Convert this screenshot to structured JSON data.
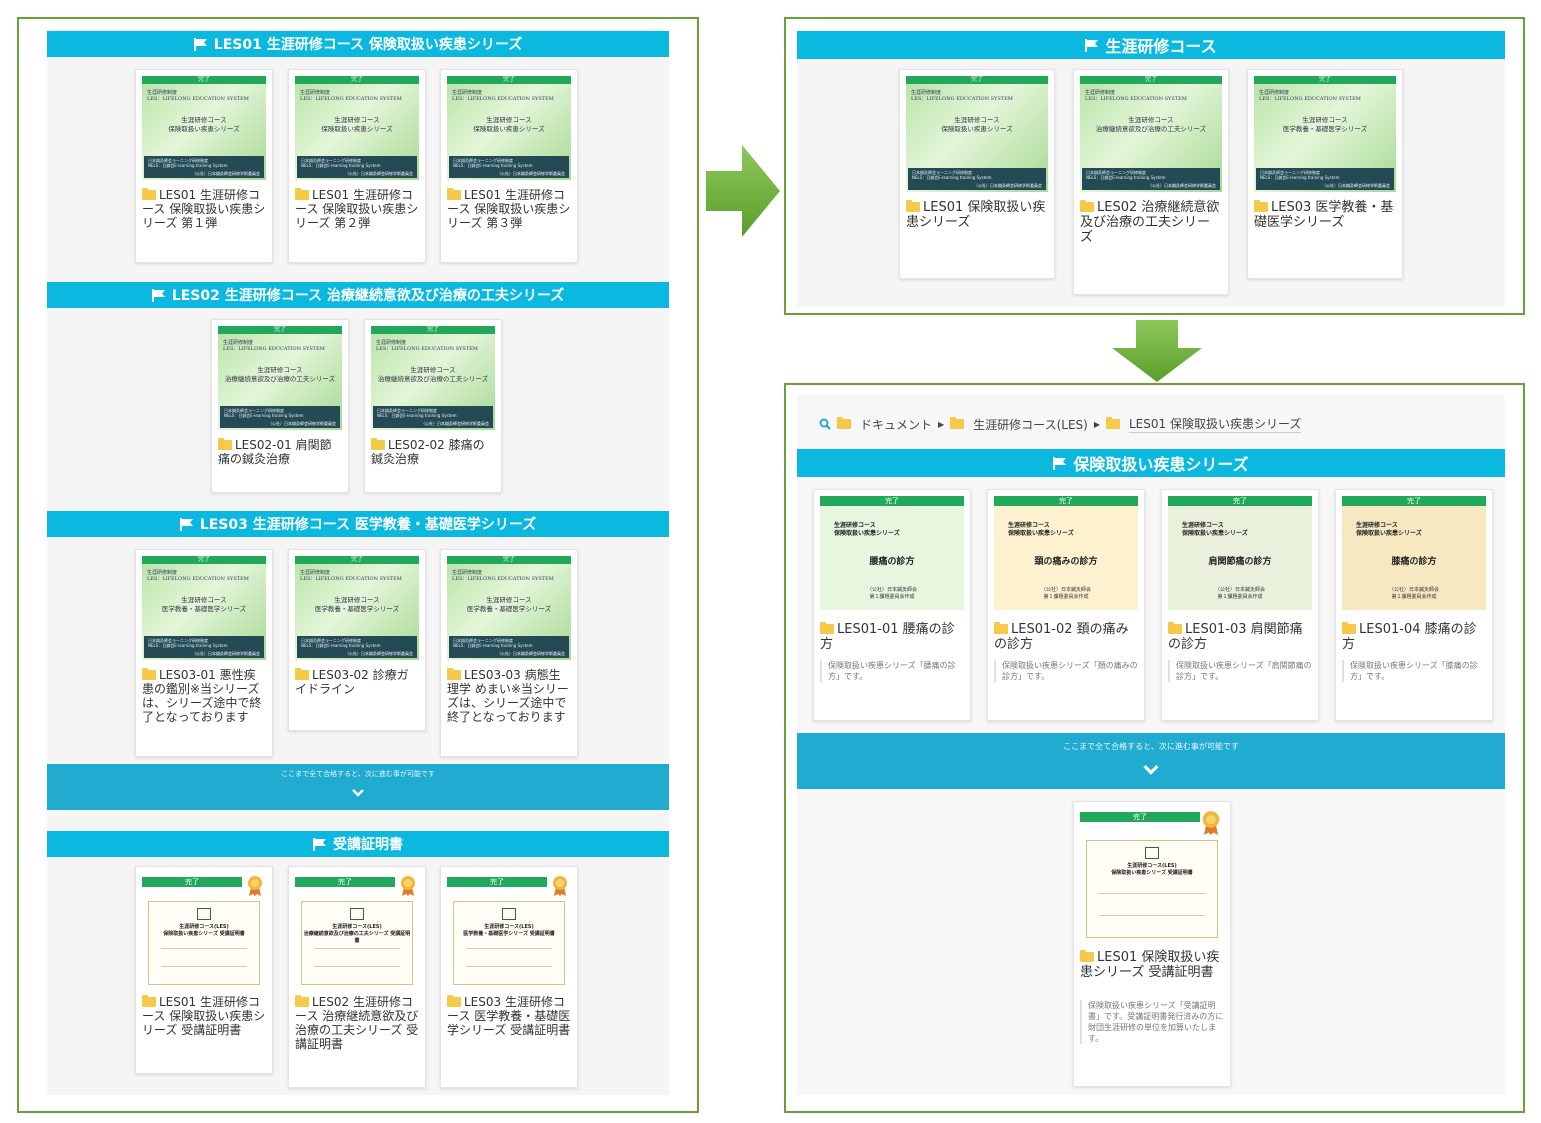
{
  "colors": {
    "section_bar": "#0bb9e0",
    "next_bar": "#21abd1",
    "done_badge": "#22a85a",
    "panel_border": "#6a9f3a",
    "arrow": "#6fb23c",
    "folder": "#f7c948"
  },
  "left_panel": {
    "sections": [
      {
        "title": "LES01 生涯研修コース 保険取扱い疾患シリーズ",
        "thumb_header": "生涯研修制度\nLES：LIFELONG EDUCATION SYSTEM",
        "thumb_subtitle": "生涯研修コース\n保険取扱い疾患シリーズ",
        "cards": [
          {
            "title": "LES01 生涯研修コース 保険取扱い疾患シリーズ 第１弾"
          },
          {
            "title": "LES01 生涯研修コース 保険取扱い疾患シリーズ 第２弾"
          },
          {
            "title": "LES01 生涯研修コース 保険取扱い疾患シリーズ 第３弾"
          }
        ]
      },
      {
        "title": "LES02 生涯研修コース 治療継続意欲及び治療の工夫シリーズ",
        "thumb_header": "生涯研修制度\nLES：LIFELONG EDUCATION SYSTEM",
        "thumb_subtitle": "生涯研修コース\n治療継続意欲及び治療の工夫シリーズ",
        "cards": [
          {
            "title": "LES02-01 肩関節痛の鍼灸治療"
          },
          {
            "title": "LES02-02 膝痛の鍼灸治療"
          }
        ]
      },
      {
        "title": "LES03 生涯研修コース 医学教養・基礎医学シリーズ",
        "thumb_header": "生涯研修制度\nLES：LIFELONG EDUCATION SYSTEM",
        "thumb_subtitle": "生涯研修コース\n医学教養・基礎医学シリーズ",
        "cards": [
          {
            "title": "LES03-01 悪性疾患の鑑別※当シリーズは、シリーズ途中で終了となっております"
          },
          {
            "title": "LES03-02 診療ガイドライン"
          },
          {
            "title": "LES03-03 病態生理学 めまい※当シリーズは、シリーズ途中で終了となっております"
          }
        ]
      }
    ],
    "thumb_done": "完了",
    "thumb_footer": "日本鍼灸師会ラーニング研修制度\nNELS：日鍼会E-learning training System",
    "thumb_org": "（公社）日本鍼灸師会研修学術委員会",
    "next_text": "ここまで全て合格すると、次に進む事が可能です",
    "cert_section": {
      "title": "受講証明書",
      "done": "完了",
      "cards": [
        {
          "thumb_text": "生涯研修コース(LES)\n保険取扱い疾患シリーズ 受講証明書",
          "title": "LES01 生涯研修コース 保険取扱い疾患シリーズ 受講証明書"
        },
        {
          "thumb_text": "生涯研修コース(LES)\n治療継続意欲及び治療の工夫シリーズ 受講証明書",
          "title": "LES02 生涯研修コース 治療継続意欲及び治療の工夫シリーズ 受講証明書"
        },
        {
          "thumb_text": "生涯研修コース(LES)\n医学教養・基礎医学シリーズ 受講証明書",
          "title": "LES03 生涯研修コース 医学教養・基礎医学シリーズ 受講証明書"
        }
      ]
    }
  },
  "top_right_panel": {
    "title": "生涯研修コース",
    "cards": [
      {
        "thumb_subtitle": "生涯研修コース\n保険取扱い疾患シリーズ",
        "title": "LES01 保険取扱い疾患シリーズ"
      },
      {
        "thumb_subtitle": "生涯研修コース\n治療継続意欲及び治療の工夫シリーズ",
        "title": "LES02 治療継続意欲及び治療の工夫シリーズ"
      },
      {
        "thumb_subtitle": "生涯研修コース\n医学教養・基礎医学シリーズ",
        "title": "LES03 医学教養・基礎医学シリーズ"
      }
    ]
  },
  "bottom_right_panel": {
    "breadcrumb": [
      "ドキュメント",
      "生涯研修コース(LES)",
      "LES01 保険取扱い疾患シリーズ"
    ],
    "title": "保険取扱い疾患シリーズ",
    "thumb_series": "生涯研修コース\n保険取扱い疾患シリーズ",
    "thumb_logo": "（公社）日本鍼灸師会\n第１課題委員会作成",
    "cards": [
      {
        "color": "#e6f6df",
        "main": "腰痛の診方",
        "title": "LES01-01 腰痛の診方",
        "desc": "保険取扱い疾患シリーズ「腰痛の診方」です。"
      },
      {
        "color": "#fdf1cf",
        "main": "頚の痛みの診方",
        "title": "LES01-02 頚の痛みの診方",
        "desc": "保険取扱い疾患シリーズ「頚の痛みの診方」です。"
      },
      {
        "color": "#e9f1dc",
        "main": "肩関節痛の診方",
        "title": "LES01-03 肩関節痛の診方",
        "desc": "保険取扱い疾患シリーズ「肩関節痛の診方」です。"
      },
      {
        "color": "#f6e8c0",
        "main": "膝痛の診方",
        "title": "LES01-04 膝痛の診方",
        "desc": "保険取扱い疾患シリーズ「膝痛の診方」です。"
      }
    ],
    "next_text": "ここまで全て合格すると、次に進む事が可能です",
    "cert": {
      "done": "完了",
      "thumb_text": "生涯研修コース(LES)\n保険取扱い疾患シリーズ 受講証明書",
      "title": "LES01 保険取扱い疾患シリーズ 受講証明書",
      "desc": "保険取扱い疾患シリーズ「受講証明書」です。受講証明書発行済みの方に財団生涯研修の単位を加算いたします。"
    }
  }
}
